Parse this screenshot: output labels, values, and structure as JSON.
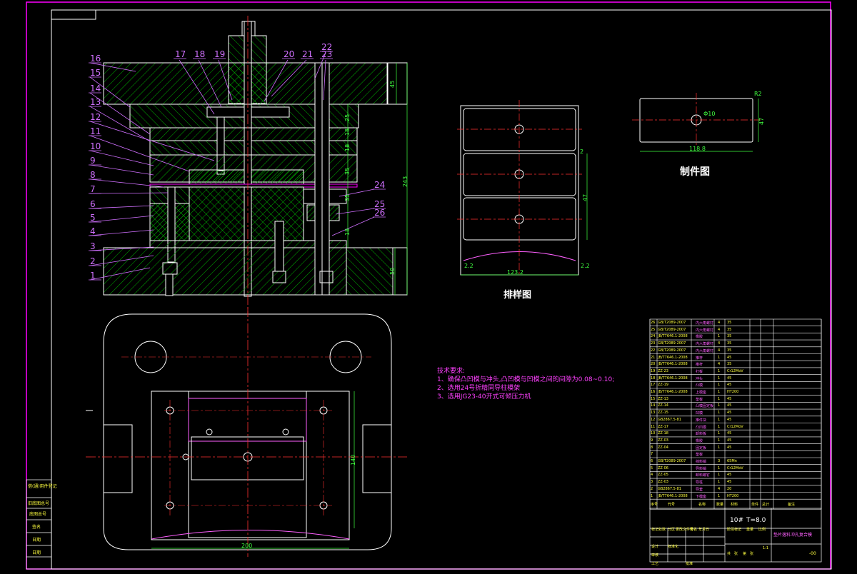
{
  "part_labels": [
    "1",
    "2",
    "3",
    "4",
    "5",
    "6",
    "7",
    "8",
    "9",
    "10",
    "11",
    "12",
    "13",
    "14",
    "15",
    "16",
    "17",
    "18",
    "19",
    "20",
    "21",
    "22",
    "23",
    "24",
    "25",
    "26"
  ],
  "dims_section": [
    "45",
    "25",
    "18",
    "18",
    "35",
    "35",
    "18",
    "50",
    "243"
  ],
  "layout_dims": [
    "2",
    "47",
    "123.2",
    "2.2",
    "2.2"
  ],
  "part_dims": [
    "R2",
    "Φ10",
    "118.8",
    "47"
  ],
  "plan_dims": [
    "140",
    "200"
  ],
  "captions": {
    "layout": "排样图",
    "part": "制件图"
  },
  "requirements": {
    "title": "技术要求:",
    "lines": [
      "1、确保凸凹模与冲头,凸凹模与凹模之间的间隙为0.08~0.10;",
      "2、选用24号折精同导柱模架",
      "3、选用JG23-40开式可倾压力机"
    ]
  },
  "bom_rows": [
    {
      "no": "26",
      "code": "GB/T2089-2007",
      "name": "内六角螺钉",
      "qty": "4",
      "mat": "35"
    },
    {
      "no": "25",
      "code": "GB/T2089-2007",
      "name": "内六角螺钉",
      "qty": "4",
      "mat": "35"
    },
    {
      "no": "24",
      "code": "JB/T7646.1-2008",
      "name": "橡胶",
      "qty": "1",
      "mat": "35"
    },
    {
      "no": "23",
      "code": "GB/T2089-2007",
      "name": "内六角螺钉",
      "qty": "4",
      "mat": "35"
    },
    {
      "no": "22",
      "code": "GB/T2089-2007",
      "name": "内六角螺钉",
      "qty": "4",
      "mat": "35"
    },
    {
      "no": "21",
      "code": "JB/T7646.1-2008",
      "name": "推杆",
      "qty": "1",
      "mat": "45"
    },
    {
      "no": "20",
      "code": "JB/T7646.1-2008",
      "name": "推杆",
      "qty": "4",
      "mat": "35"
    },
    {
      "no": "19",
      "code": "ZZ-23",
      "name": "打板",
      "qty": "1",
      "mat": "Cr12MoV"
    },
    {
      "no": "18",
      "code": "JB/T7646.1-2008",
      "name": "冲头",
      "qty": "1",
      "mat": "45"
    },
    {
      "no": "17",
      "code": "ZZ-19",
      "name": "凸模",
      "qty": "1",
      "mat": "45"
    },
    {
      "no": "16",
      "code": "JB/T7646.1-2008",
      "name": "上模座",
      "qty": "1",
      "mat": "HT200"
    },
    {
      "no": "15",
      "code": "ZZ-13",
      "name": "垫板",
      "qty": "1",
      "mat": "45"
    },
    {
      "no": "14",
      "code": "ZZ-14",
      "name": "凸模固定板",
      "qty": "1",
      "mat": "45"
    },
    {
      "no": "13",
      "code": "ZZ-15",
      "name": "凹模",
      "qty": "1",
      "mat": "45"
    },
    {
      "no": "12",
      "code": "GB2867.5-81",
      "name": "推件块",
      "qty": "1",
      "mat": "45"
    },
    {
      "no": "11",
      "code": "ZZ-17",
      "name": "凸凹模",
      "qty": "1",
      "mat": "Cr12MoV"
    },
    {
      "no": "10",
      "code": "ZZ-18",
      "name": "卸料板",
      "qty": "1",
      "mat": "45"
    },
    {
      "no": "9",
      "code": "ZZ-03",
      "name": "橡胶",
      "qty": "1",
      "mat": "45"
    },
    {
      "no": "8",
      "code": "ZZ-04",
      "name": "固定板",
      "qty": "1",
      "mat": "45"
    },
    {
      "no": "7",
      "code": "",
      "name": "垫板",
      "qty": "",
      "mat": ""
    },
    {
      "no": "6",
      "code": "GB/T2089-2007",
      "name": "挡料销",
      "qty": "3",
      "mat": "65Mn"
    },
    {
      "no": "5",
      "code": "ZZ-06",
      "name": "导料销",
      "qty": "1",
      "mat": "Cr12MoV"
    },
    {
      "no": "4",
      "code": "ZZ-05",
      "name": "卸料螺钉",
      "qty": "1",
      "mat": "45"
    },
    {
      "no": "3",
      "code": "ZZ-03",
      "name": "导柱",
      "qty": "1",
      "mat": "45"
    },
    {
      "no": "2",
      "code": "GB2867.5-81",
      "name": "导套",
      "qty": "4",
      "mat": "20"
    },
    {
      "no": "1",
      "code": "JB/T7646.1-2008",
      "name": "下模座",
      "qty": "1",
      "mat": "HT200"
    }
  ],
  "bom_header": [
    "序号",
    "代号",
    "名称",
    "数量",
    "材料",
    "单件",
    "总计",
    "备注"
  ],
  "title_block": {
    "material": "10#",
    "thickness": "T=8.0",
    "drawing_title": "垫片落料冲孔复合模",
    "drawing_no": "-00",
    "scale": "1:1",
    "rows": [
      "标记",
      "处数",
      "分区",
      "更改文件号",
      "签名",
      "年月日",
      "设计",
      "标准化",
      "审核",
      "工艺",
      "批准",
      "阶段标记",
      "重量",
      "比例",
      "共",
      "张",
      "第",
      "张"
    ]
  },
  "side_stamp": [
    "借(通)用件登记",
    "旧底图总号",
    "底图总号",
    "签名",
    "日期"
  ],
  "colors": {
    "line": "#ffffff",
    "border": "#ff00ff",
    "centerline": "#ff3030",
    "hatch": "#00c000",
    "dimension": "#40ff40",
    "leader": "#d070ff",
    "table_text": "#ffff40"
  }
}
